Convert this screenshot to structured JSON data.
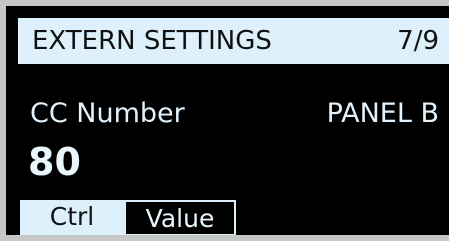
{
  "header": {
    "title": "EXTERN SETTINGS",
    "page": "7/9"
  },
  "parameter": {
    "label": "CC Number",
    "panel": "PANEL B",
    "value": "80"
  },
  "tabs": [
    {
      "label": "Ctrl",
      "selected": true
    },
    {
      "label": "Value",
      "selected": false
    }
  ],
  "colors": {
    "header_background": "#ddf0fb",
    "screen_background": "#000000",
    "text_light": "#e9f6fd",
    "text_dark": "#111111",
    "bezel": "#c6c6c6"
  }
}
